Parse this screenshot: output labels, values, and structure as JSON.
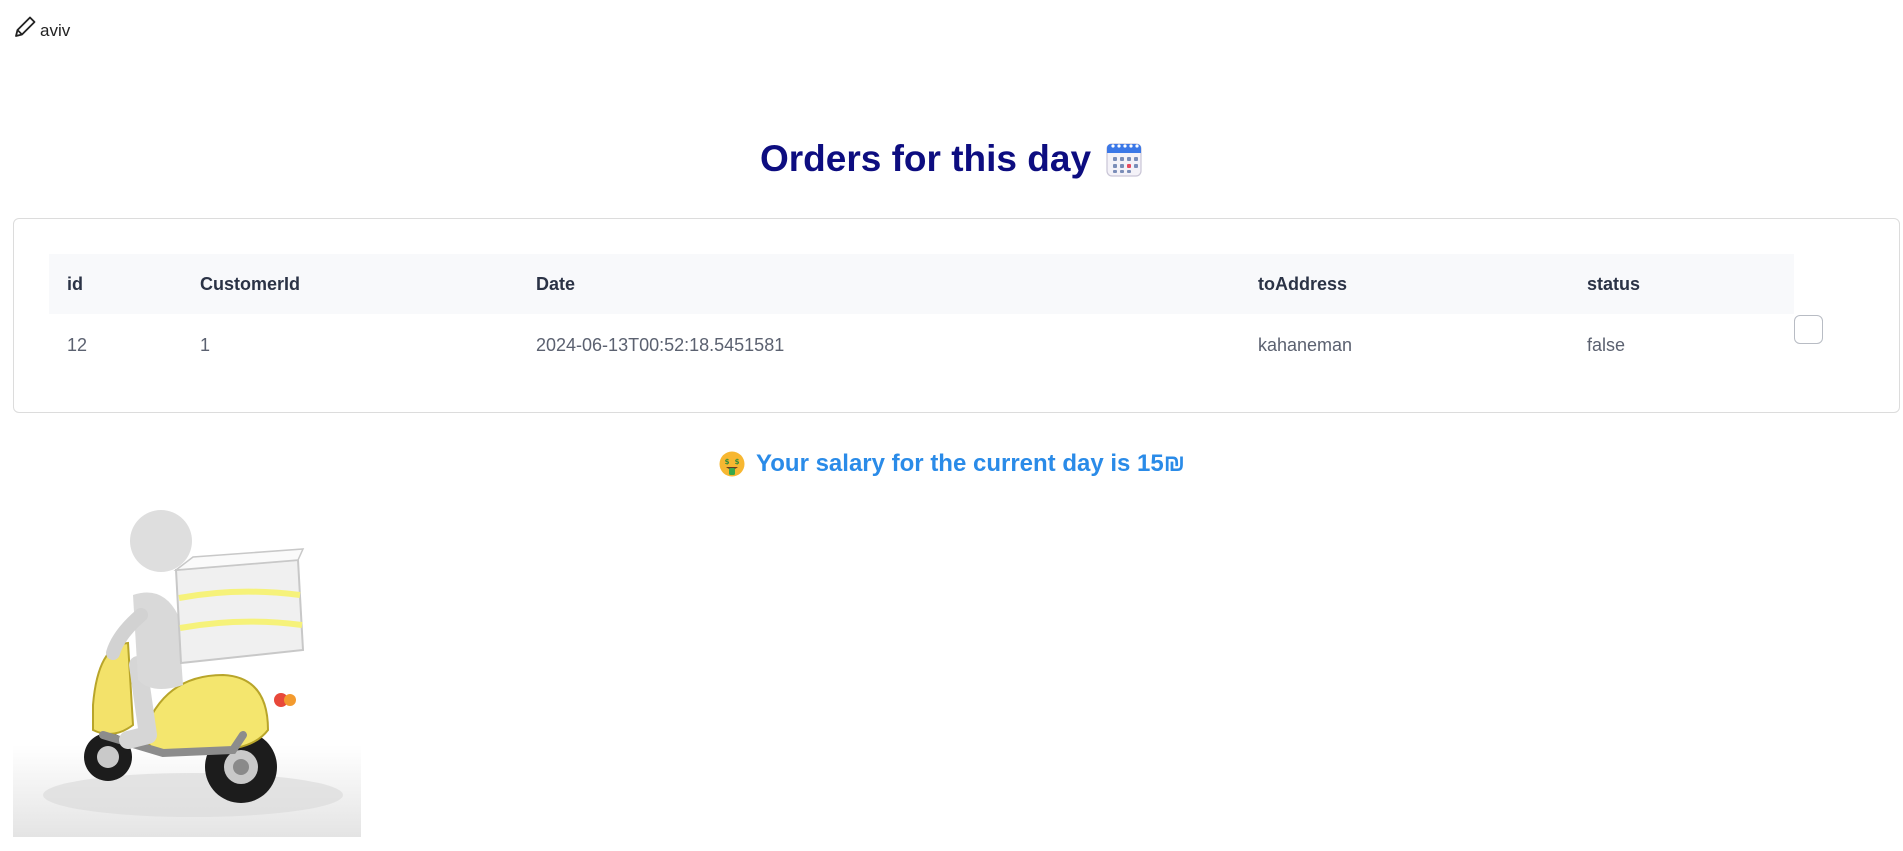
{
  "header": {
    "user_name": "aviv",
    "edit_icon": "pencil-icon"
  },
  "page": {
    "title": "Orders for this day",
    "title_icon": "calendar-icon",
    "title_color": "#0d0d80"
  },
  "orders_table": {
    "columns": [
      "id",
      "CustomerId",
      "Date",
      "toAddress",
      "status"
    ],
    "rows": [
      {
        "id": "12",
        "CustomerId": "1",
        "Date": "2024-06-13T00:52:18.5451581",
        "toAddress": "kahaneman",
        "status": "false"
      }
    ]
  },
  "salary": {
    "icon": "money-mouth-face-icon",
    "text": "Your salary for the current day is 15₪",
    "color": "#2a8be8"
  },
  "illustration": {
    "name": "delivery-scooter-image"
  }
}
